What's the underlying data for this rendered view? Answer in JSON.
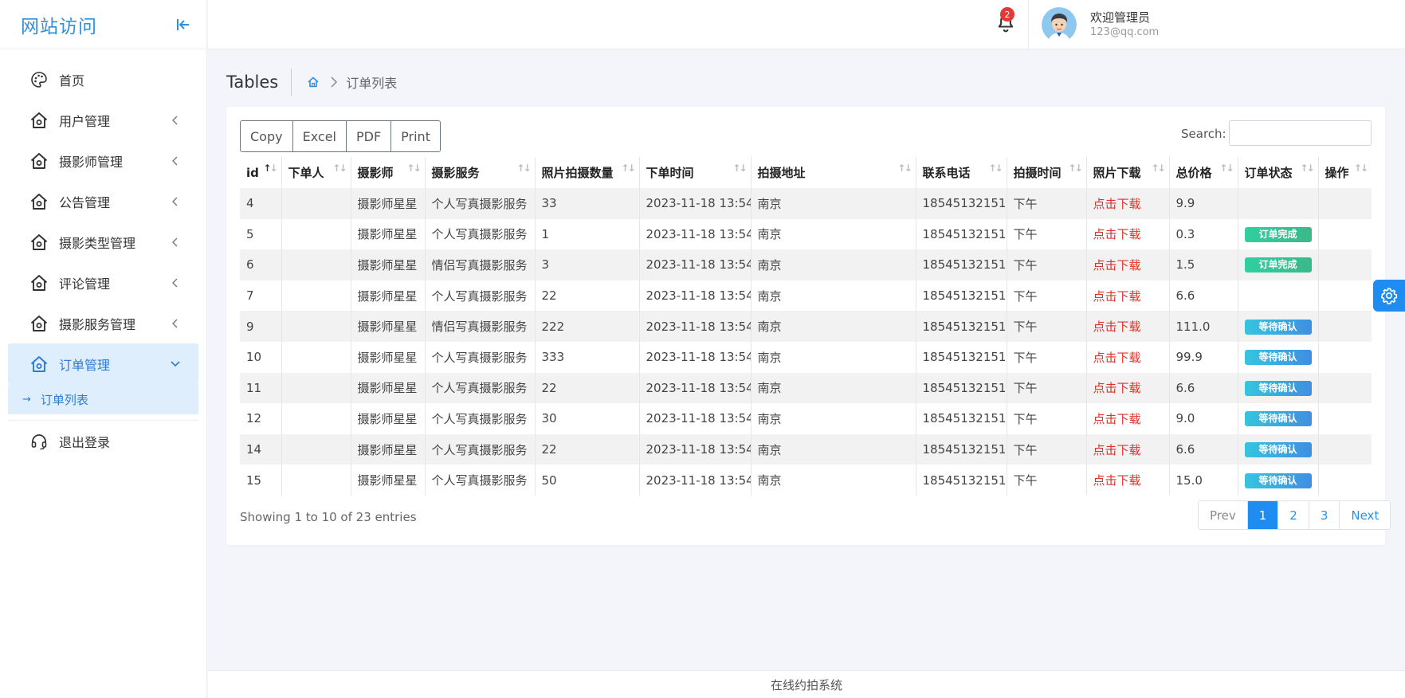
{
  "brand": {
    "title": "网站访问"
  },
  "sidebar": {
    "items": [
      {
        "label": "首页",
        "icon": "palette-icon",
        "has_caret": false
      },
      {
        "label": "用户管理",
        "icon": "home-icon",
        "has_caret": true
      },
      {
        "label": "摄影师管理",
        "icon": "home-icon",
        "has_caret": true
      },
      {
        "label": "公告管理",
        "icon": "home-icon",
        "has_caret": true
      },
      {
        "label": "摄影类型管理",
        "icon": "home-icon",
        "has_caret": true
      },
      {
        "label": "评论管理",
        "icon": "home-icon",
        "has_caret": true
      },
      {
        "label": "摄影服务管理",
        "icon": "home-icon",
        "has_caret": true
      },
      {
        "label": "订单管理",
        "icon": "home-icon",
        "has_caret": true,
        "active": true
      },
      {
        "label": "退出登录",
        "icon": "headset-icon",
        "has_caret": false
      }
    ],
    "submenu": {
      "arrow": "→",
      "label": "订单列表"
    }
  },
  "header": {
    "notification_count": "2",
    "user_name": "欢迎管理员",
    "user_email": "123@qq.com"
  },
  "page": {
    "title": "Tables",
    "breadcrumb_current": "订单列表"
  },
  "toolbar": {
    "buttons": [
      "Copy",
      "Excel",
      "PDF",
      "Print"
    ],
    "search_label": "Search:",
    "search_value": ""
  },
  "table": {
    "columns": [
      "id",
      "下单人",
      "摄影师",
      "摄影服务",
      "照片拍摄数量",
      "下单时间",
      "拍摄地址",
      "联系电话",
      "拍摄时间",
      "照片下载",
      "总价格",
      "订单状态",
      "操作"
    ],
    "rows": [
      [
        "4",
        "",
        "摄影师星星",
        "个人写真摄影服务",
        "33",
        "2023-11-18 13:54",
        "南京",
        "18545132151",
        "下午",
        "点击下载",
        "9.9",
        "",
        ""
      ],
      [
        "5",
        "",
        "摄影师星星",
        "个人写真摄影服务",
        "1",
        "2023-11-18 13:54",
        "南京",
        "18545132151",
        "下午",
        "点击下载",
        "0.3",
        "订单完成",
        ""
      ],
      [
        "6",
        "",
        "摄影师星星",
        "情侣写真摄影服务",
        "3",
        "2023-11-18 13:54",
        "南京",
        "18545132151",
        "下午",
        "点击下载",
        "1.5",
        "订单完成",
        ""
      ],
      [
        "7",
        "",
        "摄影师星星",
        "个人写真摄影服务",
        "22",
        "2023-11-18 13:54",
        "南京",
        "18545132151",
        "下午",
        "点击下载",
        "6.6",
        "",
        ""
      ],
      [
        "9",
        "",
        "摄影师星星",
        "情侣写真摄影服务",
        "222",
        "2023-11-18 13:54",
        "南京",
        "18545132151",
        "下午",
        "点击下载",
        "111.0",
        "等待确认",
        ""
      ],
      [
        "10",
        "",
        "摄影师星星",
        "个人写真摄影服务",
        "333",
        "2023-11-18 13:54",
        "南京",
        "18545132151",
        "下午",
        "点击下载",
        "99.9",
        "等待确认",
        ""
      ],
      [
        "11",
        "",
        "摄影师星星",
        "个人写真摄影服务",
        "22",
        "2023-11-18 13:54",
        "南京",
        "18545132151",
        "下午",
        "点击下载",
        "6.6",
        "等待确认",
        ""
      ],
      [
        "12",
        "",
        "摄影师星星",
        "个人写真摄影服务",
        "30",
        "2023-11-18 13:54",
        "南京",
        "18545132151",
        "下午",
        "点击下载",
        "9.0",
        "等待确认",
        ""
      ],
      [
        "14",
        "",
        "摄影师星星",
        "个人写真摄影服务",
        "22",
        "2023-11-18 13:54",
        "南京",
        "18545132151",
        "下午",
        "点击下载",
        "6.6",
        "等待确认",
        ""
      ],
      [
        "15",
        "",
        "摄影师星星",
        "个人写真摄影服务",
        "50",
        "2023-11-18 13:54",
        "南京",
        "18545132151",
        "下午",
        "点击下载",
        "15.0",
        "等待确认",
        ""
      ]
    ],
    "info": "Showing 1 to 10 of 23 entries"
  },
  "pager": {
    "prev": "Prev",
    "pages": [
      "1",
      "2",
      "3"
    ],
    "current": "1",
    "next": "Next"
  },
  "footer": {
    "text": "在线约拍系统"
  },
  "colors": {
    "accent": "#1e8cf0",
    "download_link": "#e0322d",
    "status_done": "#3cb88a",
    "status_wait": "#3f8fe0"
  }
}
